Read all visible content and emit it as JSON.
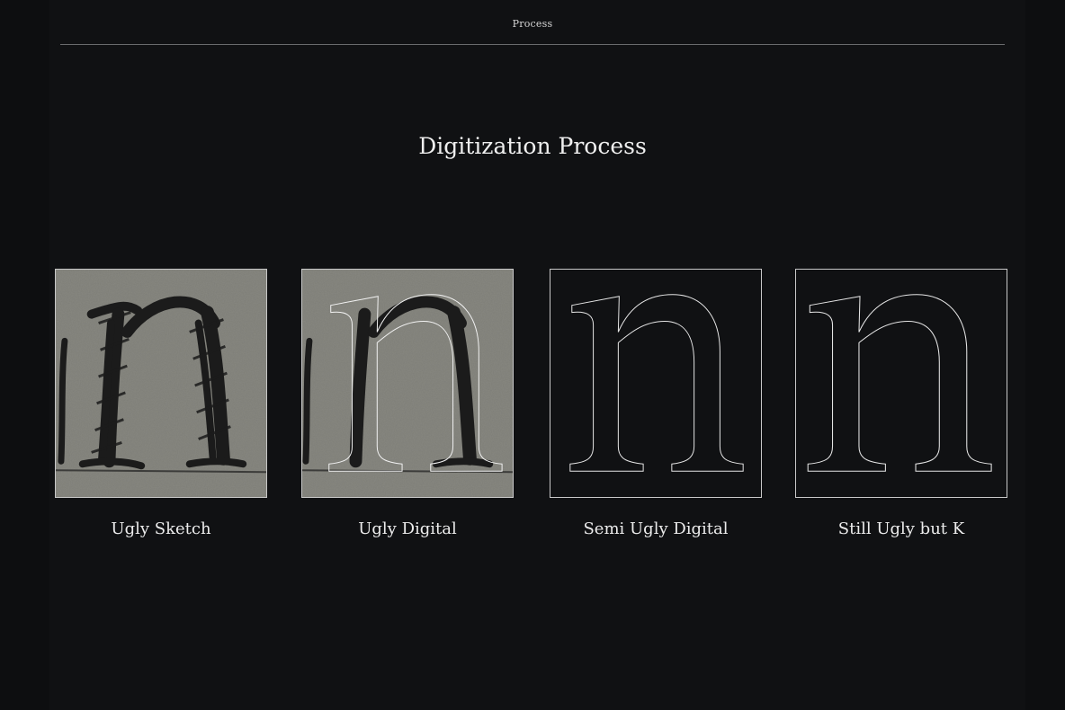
{
  "header": {
    "label": "Process"
  },
  "section": {
    "title": "Digitization Process"
  },
  "steps": [
    {
      "caption": "Ugly Sketch"
    },
    {
      "caption": "Ugly Digital"
    },
    {
      "caption": "Semi Ugly Digital"
    },
    {
      "caption": "Still Ugly but K"
    }
  ],
  "colors": {
    "background": "#0d0e10",
    "panel": "#101113",
    "paper": "#7f7f78",
    "ink": "#1a1a1a",
    "outline": "#e6e6e6"
  }
}
